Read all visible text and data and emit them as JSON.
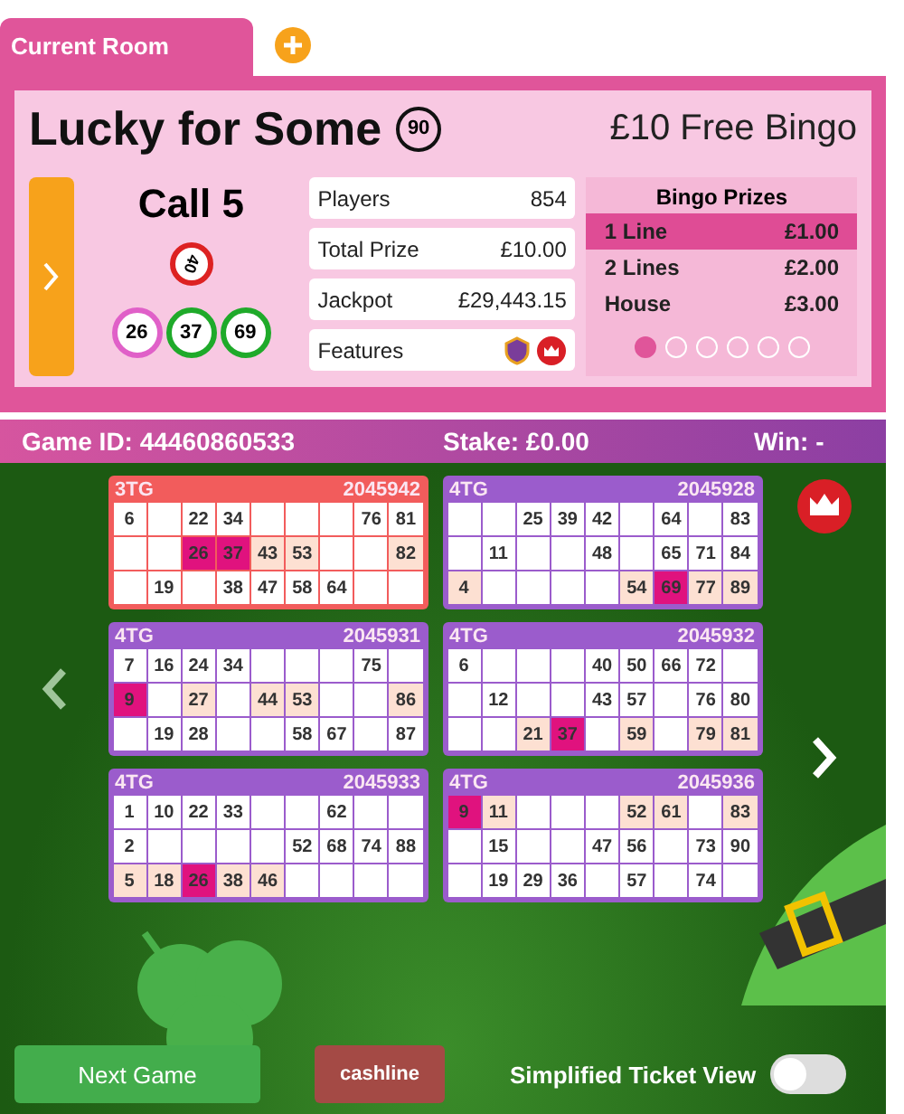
{
  "tabs": [
    {
      "label": "Current Room",
      "selected": true
    }
  ],
  "room": {
    "title": "Lucky for Some",
    "ball_type": "90",
    "offer": "£10 Free Bingo",
    "call": "Call 5",
    "current_ball": {
      "number": "40",
      "color": "#dd2222"
    },
    "recent_balls": [
      {
        "number": "26",
        "color": "#e060c8"
      },
      {
        "number": "37",
        "color": "#1faa2a"
      },
      {
        "number": "69",
        "color": "#1faa2a"
      }
    ],
    "info": [
      {
        "label": "Players",
        "value": "854"
      },
      {
        "label": "Total Prize",
        "value": "£10.00"
      },
      {
        "label": "Jackpot",
        "value": "£29,443.15"
      },
      {
        "label": "Features"
      }
    ],
    "prizes": {
      "title": "Bingo Prizes",
      "rows": [
        {
          "name": "1 Line",
          "amount": "£1.00",
          "selected": true
        },
        {
          "name": "2 Lines",
          "amount": "£2.00",
          "selected": false
        },
        {
          "name": "House",
          "amount": "£3.00",
          "selected": false
        }
      ],
      "pages": [
        {
          "selected": true
        },
        {
          "selected": false
        },
        {
          "selected": false
        },
        {
          "selected": false
        },
        {
          "selected": false
        },
        {
          "selected": false
        }
      ]
    }
  },
  "game_bar": {
    "game_id": "Game ID: 44460860533",
    "stake": "Stake: £0.00",
    "win": "Win: -"
  },
  "tickets": [
    {
      "type": "3TG",
      "serial": "2045942",
      "color": "#f25c5c",
      "rows": [
        [
          {
            "n": "6",
            "daubed": false,
            "near": false
          },
          null,
          {
            "n": "22",
            "daubed": false,
            "near": false
          },
          {
            "n": "34",
            "daubed": false,
            "near": false
          },
          null,
          null,
          null,
          {
            "n": "76",
            "daubed": false,
            "near": false
          },
          {
            "n": "81",
            "daubed": false,
            "near": false
          }
        ],
        [
          null,
          null,
          {
            "n": "26",
            "daubed": true,
            "near": false
          },
          {
            "n": "37",
            "daubed": true,
            "near": false
          },
          {
            "n": "43",
            "daubed": false,
            "near": true
          },
          {
            "n": "53",
            "daubed": false,
            "near": true
          },
          null,
          null,
          {
            "n": "82",
            "daubed": false,
            "near": true
          }
        ],
        [
          null,
          {
            "n": "19",
            "daubed": false,
            "near": false
          },
          null,
          {
            "n": "38",
            "daubed": false,
            "near": false
          },
          {
            "n": "47",
            "daubed": false,
            "near": false
          },
          {
            "n": "58",
            "daubed": false,
            "near": false
          },
          {
            "n": "64",
            "daubed": false,
            "near": false
          },
          null,
          null
        ]
      ]
    },
    {
      "type": "4TG",
      "serial": "2045928",
      "color": "#9b5ccc",
      "rows": [
        [
          null,
          null,
          {
            "n": "25",
            "daubed": false,
            "near": false
          },
          {
            "n": "39",
            "daubed": false,
            "near": false
          },
          {
            "n": "42",
            "daubed": false,
            "near": false
          },
          null,
          {
            "n": "64",
            "daubed": false,
            "near": false
          },
          null,
          {
            "n": "83",
            "daubed": false,
            "near": false
          }
        ],
        [
          null,
          {
            "n": "11",
            "daubed": false,
            "near": false
          },
          null,
          null,
          {
            "n": "48",
            "daubed": false,
            "near": false
          },
          null,
          {
            "n": "65",
            "daubed": false,
            "near": false
          },
          {
            "n": "71",
            "daubed": false,
            "near": false
          },
          {
            "n": "84",
            "daubed": false,
            "near": false
          }
        ],
        [
          {
            "n": "4",
            "daubed": false,
            "near": true
          },
          null,
          null,
          null,
          null,
          {
            "n": "54",
            "daubed": false,
            "near": true
          },
          {
            "n": "69",
            "daubed": true,
            "near": false
          },
          {
            "n": "77",
            "daubed": false,
            "near": true
          },
          {
            "n": "89",
            "daubed": false,
            "near": true
          }
        ]
      ]
    },
    {
      "type": "4TG",
      "serial": "2045931",
      "color": "#9b5ccc",
      "rows": [
        [
          {
            "n": "7",
            "daubed": false,
            "near": false
          },
          {
            "n": "16",
            "daubed": false,
            "near": false
          },
          {
            "n": "24",
            "daubed": false,
            "near": false
          },
          {
            "n": "34",
            "daubed": false,
            "near": false
          },
          null,
          null,
          null,
          {
            "n": "75",
            "daubed": false,
            "near": false
          },
          null
        ],
        [
          {
            "n": "9",
            "daubed": true,
            "near": false
          },
          null,
          {
            "n": "27",
            "daubed": false,
            "near": true
          },
          null,
          {
            "n": "44",
            "daubed": false,
            "near": true
          },
          {
            "n": "53",
            "daubed": false,
            "near": true
          },
          null,
          null,
          {
            "n": "86",
            "daubed": false,
            "near": true
          }
        ],
        [
          null,
          {
            "n": "19",
            "daubed": false,
            "near": false
          },
          {
            "n": "28",
            "daubed": false,
            "near": false
          },
          null,
          null,
          {
            "n": "58",
            "daubed": false,
            "near": false
          },
          {
            "n": "67",
            "daubed": false,
            "near": false
          },
          null,
          {
            "n": "87",
            "daubed": false,
            "near": false
          }
        ]
      ]
    },
    {
      "type": "4TG",
      "serial": "2045932",
      "color": "#9b5ccc",
      "rows": [
        [
          {
            "n": "6",
            "daubed": false,
            "near": false
          },
          null,
          null,
          null,
          {
            "n": "40",
            "daubed": false,
            "near": false
          },
          {
            "n": "50",
            "daubed": false,
            "near": false
          },
          {
            "n": "66",
            "daubed": false,
            "near": false
          },
          {
            "n": "72",
            "daubed": false,
            "near": false
          },
          null
        ],
        [
          null,
          {
            "n": "12",
            "daubed": false,
            "near": false
          },
          null,
          null,
          {
            "n": "43",
            "daubed": false,
            "near": false
          },
          {
            "n": "57",
            "daubed": false,
            "near": false
          },
          null,
          {
            "n": "76",
            "daubed": false,
            "near": false
          },
          {
            "n": "80",
            "daubed": false,
            "near": false
          }
        ],
        [
          null,
          null,
          {
            "n": "21",
            "daubed": false,
            "near": true
          },
          {
            "n": "37",
            "daubed": true,
            "near": false
          },
          null,
          {
            "n": "59",
            "daubed": false,
            "near": true
          },
          null,
          {
            "n": "79",
            "daubed": false,
            "near": true
          },
          {
            "n": "81",
            "daubed": false,
            "near": true
          }
        ]
      ]
    },
    {
      "type": "4TG",
      "serial": "2045933",
      "color": "#9b5ccc",
      "rows": [
        [
          {
            "n": "1",
            "daubed": false,
            "near": false
          },
          {
            "n": "10",
            "daubed": false,
            "near": false
          },
          {
            "n": "22",
            "daubed": false,
            "near": false
          },
          {
            "n": "33",
            "daubed": false,
            "near": false
          },
          null,
          null,
          {
            "n": "62",
            "daubed": false,
            "near": false
          },
          null,
          null
        ],
        [
          {
            "n": "2",
            "daubed": false,
            "near": false
          },
          null,
          null,
          null,
          null,
          {
            "n": "52",
            "daubed": false,
            "near": false
          },
          {
            "n": "68",
            "daubed": false,
            "near": false
          },
          {
            "n": "74",
            "daubed": false,
            "near": false
          },
          {
            "n": "88",
            "daubed": false,
            "near": false
          }
        ],
        [
          {
            "n": "5",
            "daubed": false,
            "near": true
          },
          {
            "n": "18",
            "daubed": false,
            "near": true
          },
          {
            "n": "26",
            "daubed": true,
            "near": false
          },
          {
            "n": "38",
            "daubed": false,
            "near": true
          },
          {
            "n": "46",
            "daubed": false,
            "near": true
          },
          null,
          null,
          null,
          null
        ]
      ]
    },
    {
      "type": "4TG",
      "serial": "2045936",
      "color": "#9b5ccc",
      "rows": [
        [
          {
            "n": "9",
            "daubed": true,
            "near": false
          },
          {
            "n": "11",
            "daubed": false,
            "near": true
          },
          null,
          null,
          null,
          {
            "n": "52",
            "daubed": false,
            "near": true
          },
          {
            "n": "61",
            "daubed": false,
            "near": true
          },
          null,
          {
            "n": "83",
            "daubed": false,
            "near": true
          }
        ],
        [
          null,
          {
            "n": "15",
            "daubed": false,
            "near": false
          },
          null,
          null,
          {
            "n": "47",
            "daubed": false,
            "near": false
          },
          {
            "n": "56",
            "daubed": false,
            "near": false
          },
          null,
          {
            "n": "73",
            "daubed": false,
            "near": false
          },
          {
            "n": "90",
            "daubed": false,
            "near": false
          }
        ],
        [
          null,
          {
            "n": "19",
            "daubed": false,
            "near": false
          },
          {
            "n": "29",
            "daubed": false,
            "near": false
          },
          {
            "n": "36",
            "daubed": false,
            "near": false
          },
          null,
          {
            "n": "57",
            "daubed": false,
            "near": false
          },
          null,
          {
            "n": "74",
            "daubed": false,
            "near": false
          },
          null
        ]
      ]
    }
  ],
  "next_button": "Next Game",
  "cashline_logo": "cashline",
  "toggle": {
    "label": "Simplified Ticket View",
    "on": false
  }
}
